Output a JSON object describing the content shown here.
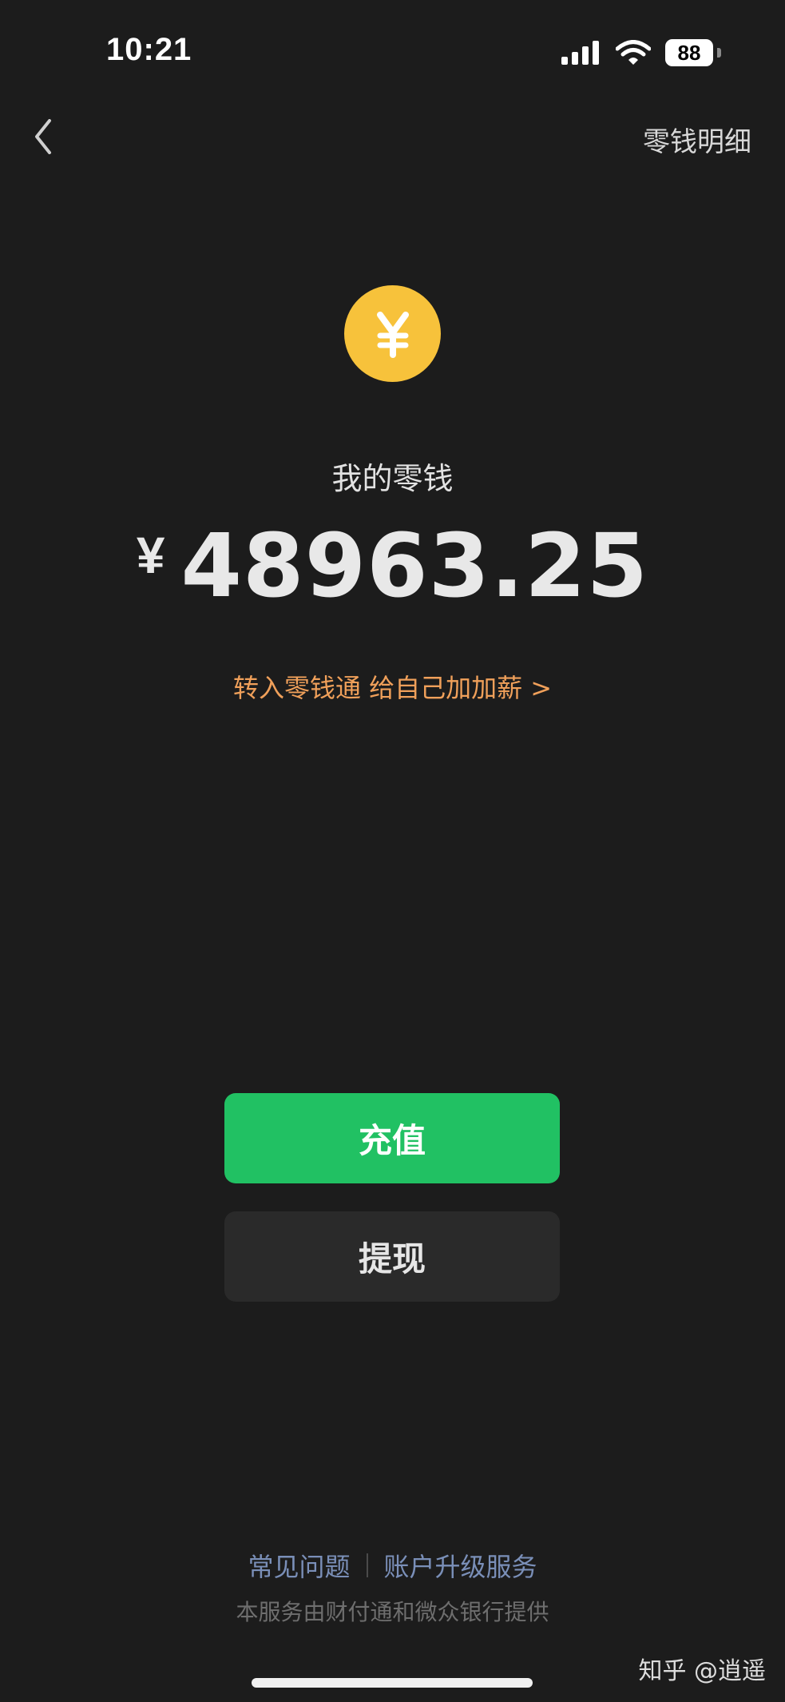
{
  "status_bar": {
    "time": "10:21",
    "battery": "88",
    "icons": [
      "signal-icon",
      "wifi-icon",
      "battery-icon"
    ]
  },
  "nav": {
    "back_icon": "chevron-left-icon",
    "right_link": "零钱明细"
  },
  "balance": {
    "icon": "yuan-coin-icon",
    "label": "我的零钱",
    "currency": "¥",
    "amount": "48963.25"
  },
  "promo": {
    "text": "转入零钱通 给自己加加薪",
    "chevron": ">"
  },
  "actions": {
    "recharge": "充值",
    "withdraw": "提现"
  },
  "footer": {
    "faq": "常见问题",
    "upgrade": "账户升级服务",
    "provider": "本服务由财付通和微众银行提供"
  },
  "watermark": "知乎 @逍遥",
  "colors": {
    "background": "#1c1c1c",
    "coin": "#f7c23b",
    "recharge_button": "#21c163",
    "withdraw_button": "#2a2a2a",
    "promo_text": "#f0a05a",
    "footer_link": "#7a8fb8"
  }
}
